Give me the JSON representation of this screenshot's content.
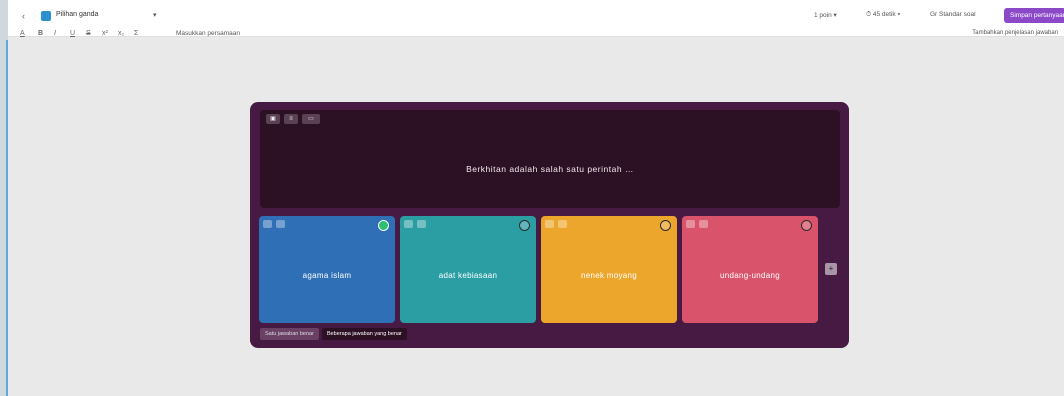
{
  "toolbar": {
    "back": "‹",
    "question_type": "Pilihan ganda",
    "caret": "▾",
    "points": "1 poin ▾",
    "time": "⏱ 45 detik ▾",
    "standard": "Gr Standar soal",
    "save": "Simpan pertanyaan"
  },
  "format": {
    "items": [
      "A",
      "B",
      "I",
      "U",
      "S",
      "x²",
      "x₂",
      "Σ"
    ],
    "insert_equation": "Masukkan persamaan",
    "add_explanation": "Tambahkan penjelasan jawaban"
  },
  "question": {
    "tools": [
      "▣",
      "≡",
      "▭"
    ],
    "text": "Berkhitan adalah salah satu perintah …"
  },
  "options": [
    {
      "text": "agama islam",
      "color": "#2f6fb5",
      "correct": true
    },
    {
      "text": "adat kebiasaan",
      "color": "#2b9ea3",
      "correct": false
    },
    {
      "text": "nenek moyang",
      "color": "#eca62c",
      "correct": false
    },
    {
      "text": "undang-undang",
      "color": "#d9546a",
      "correct": false
    }
  ],
  "add_option": "+",
  "modes": [
    "Satu jawaban benar",
    "Beberapa jawaban yang benar"
  ]
}
